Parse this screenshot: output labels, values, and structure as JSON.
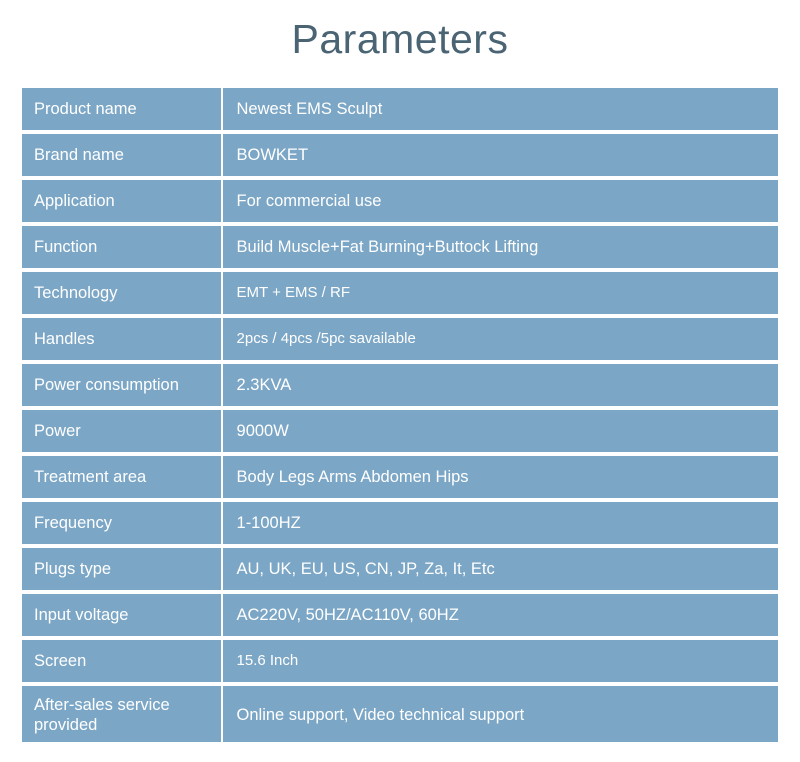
{
  "title": "Parameters",
  "colors": {
    "row_blue": "#7ba6c6",
    "title_text": "#4a6474",
    "cell_text": "#ffffff",
    "background": "#ffffff"
  },
  "table": {
    "rows": [
      {
        "label": "Product name",
        "value": "Newest EMS Sculpt"
      },
      {
        "label": "Brand name",
        "value": "BOWKET"
      },
      {
        "label": "Application",
        "value": "For commercial use"
      },
      {
        "label": "Function",
        "value": "Build Muscle+Fat Burning+Buttock Lifting"
      },
      {
        "label": "Technology",
        "value": "EMT + EMS / RF"
      },
      {
        "label": "Handles",
        "value": "2pcs / 4pcs /5pc savailable"
      },
      {
        "label": "Power consumption",
        "value": "2.3KVA"
      },
      {
        "label": "Power",
        "value": "9000W"
      },
      {
        "label": "Treatment area",
        "value": "Body Legs Arms Abdomen Hips"
      },
      {
        "label": "Frequency",
        "value": "1-100HZ"
      },
      {
        "label": "Plugs type",
        "value": "AU, UK, EU, US, CN, JP, Za, It, Etc"
      },
      {
        "label": "Input voltage",
        "value": "AC220V, 50HZ/AC110V, 60HZ"
      },
      {
        "label": "Screen",
        "value": "15.6 Inch"
      },
      {
        "label": "After-sales service provided",
        "value": "Online support, Video technical support"
      }
    ]
  }
}
